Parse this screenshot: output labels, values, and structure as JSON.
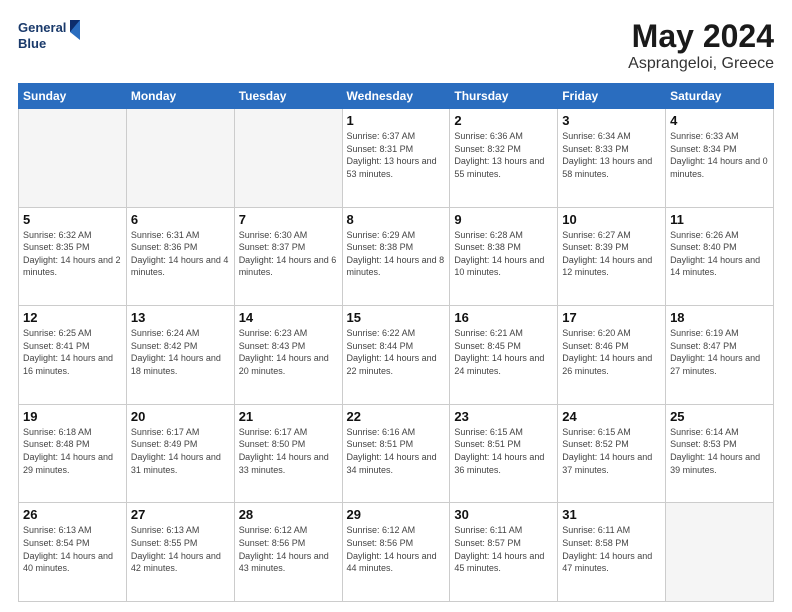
{
  "header": {
    "logo_line1": "General",
    "logo_line2": "Blue",
    "month": "May 2024",
    "location": "Asprangeloi, Greece"
  },
  "weekdays": [
    "Sunday",
    "Monday",
    "Tuesday",
    "Wednesday",
    "Thursday",
    "Friday",
    "Saturday"
  ],
  "weeks": [
    [
      {
        "day": "",
        "empty": true
      },
      {
        "day": "",
        "empty": true
      },
      {
        "day": "",
        "empty": true
      },
      {
        "day": "1",
        "sunrise": "6:37 AM",
        "sunset": "8:31 PM",
        "daylight": "13 hours and 53 minutes."
      },
      {
        "day": "2",
        "sunrise": "6:36 AM",
        "sunset": "8:32 PM",
        "daylight": "13 hours and 55 minutes."
      },
      {
        "day": "3",
        "sunrise": "6:34 AM",
        "sunset": "8:33 PM",
        "daylight": "13 hours and 58 minutes."
      },
      {
        "day": "4",
        "sunrise": "6:33 AM",
        "sunset": "8:34 PM",
        "daylight": "14 hours and 0 minutes."
      }
    ],
    [
      {
        "day": "5",
        "sunrise": "6:32 AM",
        "sunset": "8:35 PM",
        "daylight": "14 hours and 2 minutes."
      },
      {
        "day": "6",
        "sunrise": "6:31 AM",
        "sunset": "8:36 PM",
        "daylight": "14 hours and 4 minutes."
      },
      {
        "day": "7",
        "sunrise": "6:30 AM",
        "sunset": "8:37 PM",
        "daylight": "14 hours and 6 minutes."
      },
      {
        "day": "8",
        "sunrise": "6:29 AM",
        "sunset": "8:38 PM",
        "daylight": "14 hours and 8 minutes."
      },
      {
        "day": "9",
        "sunrise": "6:28 AM",
        "sunset": "8:38 PM",
        "daylight": "14 hours and 10 minutes."
      },
      {
        "day": "10",
        "sunrise": "6:27 AM",
        "sunset": "8:39 PM",
        "daylight": "14 hours and 12 minutes."
      },
      {
        "day": "11",
        "sunrise": "6:26 AM",
        "sunset": "8:40 PM",
        "daylight": "14 hours and 14 minutes."
      }
    ],
    [
      {
        "day": "12",
        "sunrise": "6:25 AM",
        "sunset": "8:41 PM",
        "daylight": "14 hours and 16 minutes."
      },
      {
        "day": "13",
        "sunrise": "6:24 AM",
        "sunset": "8:42 PM",
        "daylight": "14 hours and 18 minutes."
      },
      {
        "day": "14",
        "sunrise": "6:23 AM",
        "sunset": "8:43 PM",
        "daylight": "14 hours and 20 minutes."
      },
      {
        "day": "15",
        "sunrise": "6:22 AM",
        "sunset": "8:44 PM",
        "daylight": "14 hours and 22 minutes."
      },
      {
        "day": "16",
        "sunrise": "6:21 AM",
        "sunset": "8:45 PM",
        "daylight": "14 hours and 24 minutes."
      },
      {
        "day": "17",
        "sunrise": "6:20 AM",
        "sunset": "8:46 PM",
        "daylight": "14 hours and 26 minutes."
      },
      {
        "day": "18",
        "sunrise": "6:19 AM",
        "sunset": "8:47 PM",
        "daylight": "14 hours and 27 minutes."
      }
    ],
    [
      {
        "day": "19",
        "sunrise": "6:18 AM",
        "sunset": "8:48 PM",
        "daylight": "14 hours and 29 minutes."
      },
      {
        "day": "20",
        "sunrise": "6:17 AM",
        "sunset": "8:49 PM",
        "daylight": "14 hours and 31 minutes."
      },
      {
        "day": "21",
        "sunrise": "6:17 AM",
        "sunset": "8:50 PM",
        "daylight": "14 hours and 33 minutes."
      },
      {
        "day": "22",
        "sunrise": "6:16 AM",
        "sunset": "8:51 PM",
        "daylight": "14 hours and 34 minutes."
      },
      {
        "day": "23",
        "sunrise": "6:15 AM",
        "sunset": "8:51 PM",
        "daylight": "14 hours and 36 minutes."
      },
      {
        "day": "24",
        "sunrise": "6:15 AM",
        "sunset": "8:52 PM",
        "daylight": "14 hours and 37 minutes."
      },
      {
        "day": "25",
        "sunrise": "6:14 AM",
        "sunset": "8:53 PM",
        "daylight": "14 hours and 39 minutes."
      }
    ],
    [
      {
        "day": "26",
        "sunrise": "6:13 AM",
        "sunset": "8:54 PM",
        "daylight": "14 hours and 40 minutes."
      },
      {
        "day": "27",
        "sunrise": "6:13 AM",
        "sunset": "8:55 PM",
        "daylight": "14 hours and 42 minutes."
      },
      {
        "day": "28",
        "sunrise": "6:12 AM",
        "sunset": "8:56 PM",
        "daylight": "14 hours and 43 minutes."
      },
      {
        "day": "29",
        "sunrise": "6:12 AM",
        "sunset": "8:56 PM",
        "daylight": "14 hours and 44 minutes."
      },
      {
        "day": "30",
        "sunrise": "6:11 AM",
        "sunset": "8:57 PM",
        "daylight": "14 hours and 45 minutes."
      },
      {
        "day": "31",
        "sunrise": "6:11 AM",
        "sunset": "8:58 PM",
        "daylight": "14 hours and 47 minutes."
      },
      {
        "day": "",
        "empty": true
      }
    ]
  ],
  "labels": {
    "sunrise": "Sunrise:",
    "sunset": "Sunset:",
    "daylight": "Daylight:"
  }
}
